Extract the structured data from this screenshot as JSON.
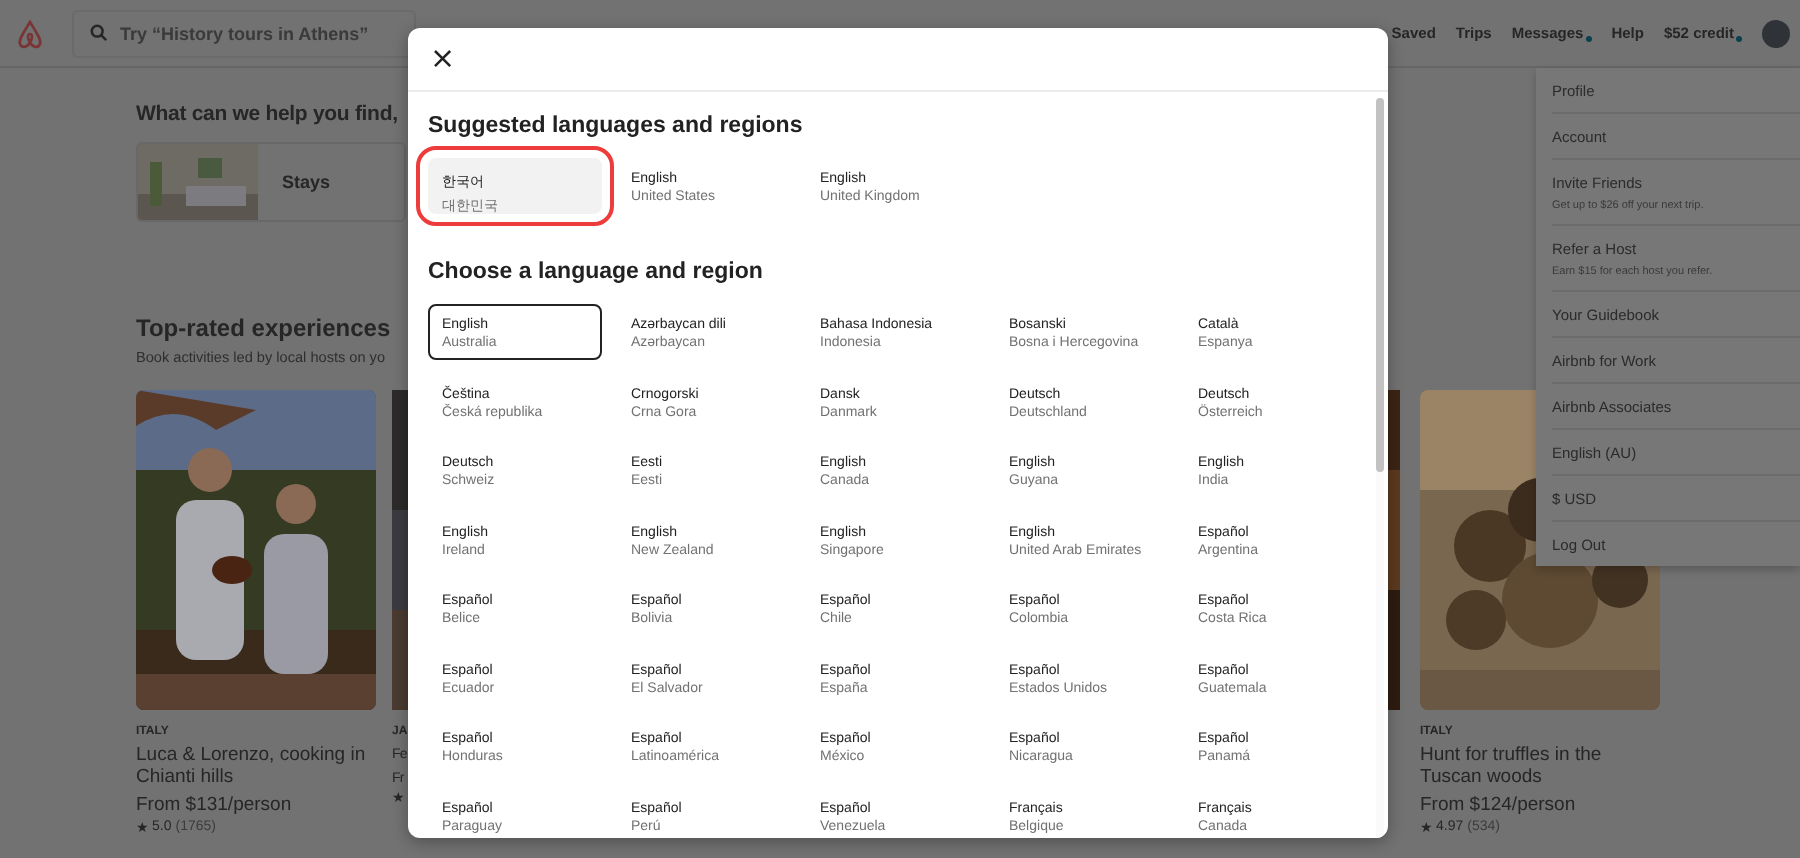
{
  "header": {
    "search": {
      "placeholder": "Try “History tours in Athens”"
    },
    "nav": [
      {
        "label": "Saved",
        "dot": false
      },
      {
        "label": "Trips",
        "dot": false
      },
      {
        "label": "Messages",
        "dot": true
      },
      {
        "label": "Help",
        "dot": false
      },
      {
        "label": "$52 credit",
        "dot": true
      }
    ]
  },
  "page": {
    "heading": "What can we help you find,",
    "categories": [
      {
        "label": "Stays"
      }
    ],
    "experiences": {
      "title": "Top-rated experiences",
      "subtitle": "Book activities led by local hosts on yo",
      "cards": [
        {
          "country": "ITALY",
          "title": "Luca & Lorenzo, cooking in Chianti hills",
          "price": "From $131/person",
          "star": "★",
          "rating": "5.0",
          "reviews": "(1765)",
          "kind": "people"
        },
        {
          "country": "JA",
          "title": "Fe",
          "price": "Fr",
          "star": "★",
          "kind": "cut"
        },
        {
          "kind": "sliver"
        },
        {
          "country": "ITALY",
          "title": "Hunt for truffles in the Tuscan woods",
          "price": "From $124/person",
          "star": "★",
          "rating": "4.97",
          "reviews": "(534)",
          "kind": "food"
        }
      ]
    }
  },
  "account_menu": [
    {
      "label": "Profile"
    },
    {
      "label": "Account"
    },
    {
      "label": "Invite Friends",
      "note": "Get up to $26 off your next trip."
    },
    {
      "label": "Refer a Host",
      "note": "Earn $15 for each host you refer."
    },
    {
      "label": "Your Guidebook"
    },
    {
      "label": "Airbnb for Work"
    },
    {
      "label": "Airbnb Associates"
    },
    {
      "label": "English (AU)"
    },
    {
      "label": "$ USD"
    },
    {
      "label": "Log Out"
    }
  ],
  "dialog": {
    "close": "×",
    "suggested_title": "Suggested languages and regions",
    "suggested": [
      {
        "language": "한국어",
        "region": "대한민국",
        "selected": true
      },
      {
        "language": "English",
        "region": "United States",
        "selected": false
      },
      {
        "language": "English",
        "region": "United Kingdom",
        "selected": false
      }
    ],
    "choose_title": "Choose a language and region",
    "languages": [
      {
        "language": "English",
        "region": "Australia",
        "selected": true
      },
      {
        "language": "Azərbaycan dili",
        "region": "Azərbaycan",
        "selected": false
      },
      {
        "language": "Bahasa Indonesia",
        "region": "Indonesia",
        "selected": false
      },
      {
        "language": "Bosanski",
        "region": "Bosna i Hercegovina",
        "selected": false
      },
      {
        "language": "Català",
        "region": "Espanya",
        "selected": false
      },
      {
        "language": "Čeština",
        "region": "Česká republika",
        "selected": false
      },
      {
        "language": "Crnogorski",
        "region": "Crna Gora",
        "selected": false
      },
      {
        "language": "Dansk",
        "region": "Danmark",
        "selected": false
      },
      {
        "language": "Deutsch",
        "region": "Deutschland",
        "selected": false
      },
      {
        "language": "Deutsch",
        "region": "Österreich",
        "selected": false
      },
      {
        "language": "Deutsch",
        "region": "Schweiz",
        "selected": false
      },
      {
        "language": "Eesti",
        "region": "Eesti",
        "selected": false
      },
      {
        "language": "English",
        "region": "Canada",
        "selected": false
      },
      {
        "language": "English",
        "region": "Guyana",
        "selected": false
      },
      {
        "language": "English",
        "region": "India",
        "selected": false
      },
      {
        "language": "English",
        "region": "Ireland",
        "selected": false
      },
      {
        "language": "English",
        "region": "New Zealand",
        "selected": false
      },
      {
        "language": "English",
        "region": "Singapore",
        "selected": false
      },
      {
        "language": "English",
        "region": "United Arab Emirates",
        "selected": false
      },
      {
        "language": "Español",
        "region": "Argentina",
        "selected": false
      },
      {
        "language": "Español",
        "region": "Belice",
        "selected": false
      },
      {
        "language": "Español",
        "region": "Bolivia",
        "selected": false
      },
      {
        "language": "Español",
        "region": "Chile",
        "selected": false
      },
      {
        "language": "Español",
        "region": "Colombia",
        "selected": false
      },
      {
        "language": "Español",
        "region": "Costa Rica",
        "selected": false
      },
      {
        "language": "Español",
        "region": "Ecuador",
        "selected": false
      },
      {
        "language": "Español",
        "region": "El Salvador",
        "selected": false
      },
      {
        "language": "Español",
        "region": "España",
        "selected": false
      },
      {
        "language": "Español",
        "region": "Estados Unidos",
        "selected": false
      },
      {
        "language": "Español",
        "region": "Guatemala",
        "selected": false
      },
      {
        "language": "Español",
        "region": "Honduras",
        "selected": false
      },
      {
        "language": "Español",
        "region": "Latinoamérica",
        "selected": false
      },
      {
        "language": "Español",
        "region": "México",
        "selected": false
      },
      {
        "language": "Español",
        "region": "Nicaragua",
        "selected": false
      },
      {
        "language": "Español",
        "region": "Panamá",
        "selected": false
      },
      {
        "language": "Español",
        "region": "Paraguay",
        "selected": false
      },
      {
        "language": "Español",
        "region": "Perú",
        "selected": false
      },
      {
        "language": "Español",
        "region": "Venezuela",
        "selected": false
      },
      {
        "language": "Français",
        "region": "Belgique",
        "selected": false
      },
      {
        "language": "Français",
        "region": "Canada",
        "selected": false
      }
    ]
  }
}
